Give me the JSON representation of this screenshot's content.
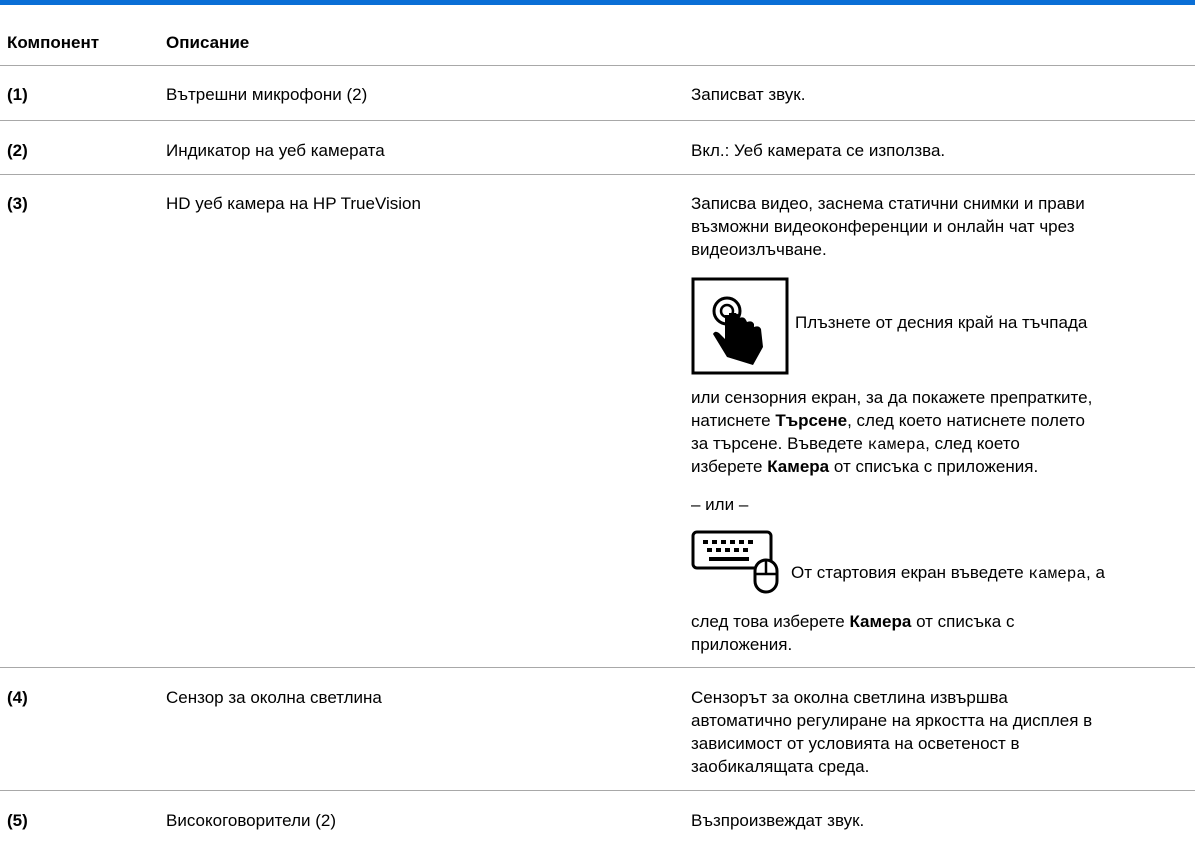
{
  "table": {
    "headers": {
      "component": "Компонент",
      "description": "Описание"
    },
    "rows": [
      {
        "num": "(1)",
        "name": "Вътрешни микрофони (2)",
        "desc": "Записват звук."
      },
      {
        "num": "(2)",
        "name": "Индикатор на уеб камерата",
        "desc": "Вкл.: Уеб камерата се използва."
      },
      {
        "num": "(3)",
        "name": "HD уеб камера на HP TrueVision",
        "desc_intro_l1": "Записва видео, заснема статични снимки и прави",
        "desc_intro_l2": "възможни видеоконференции и онлайн чат чрез",
        "desc_intro_l3": "видеоизлъчване.",
        "touch_icon": "touch-swipe-icon",
        "touch_text": "Плъзнете от десния край на тъчпада",
        "touch_cont_l1": "или сензорния екран, за да покажете препратките,",
        "touch_cont_l2_a": "натиснете ",
        "touch_cont_l2_b": "Търсене",
        "touch_cont_l2_c": ", след което натиснете полето",
        "touch_cont_l3_a": "за търсене. Въведете ",
        "touch_cont_l3_code": "камера",
        "touch_cont_l3_c": ", след което",
        "touch_cont_l4_a": "изберете ",
        "touch_cont_l4_b": "Камера",
        "touch_cont_l4_c": " от списъка с приложения.",
        "or_text": "– или –",
        "kb_icon": "keyboard-mouse-icon",
        "kb_text_a": " От стартовия екран въведете ",
        "kb_text_code": "камера",
        "kb_text_c": ", а",
        "kb_cont_l1_a": "след това изберете ",
        "kb_cont_l1_b": "Камера",
        "kb_cont_l1_c": " от списъка с",
        "kb_cont_l2": "приложения."
      },
      {
        "num": "(4)",
        "name": "Сензор за околна светлина",
        "desc_l1": "Сензорът за околна светлина извършва",
        "desc_l2": "автоматично регулиране на яркостта на дисплея в",
        "desc_l3": "зависимост от условията на осветеност в",
        "desc_l4": "заобикалящата среда."
      },
      {
        "num": "(5)",
        "name": "Високоговорители (2)",
        "desc": "Възпроизвеждат звук."
      }
    ]
  },
  "colors": {
    "accent_rule": "#0a6fd6",
    "divider": "#a8a8a8"
  }
}
